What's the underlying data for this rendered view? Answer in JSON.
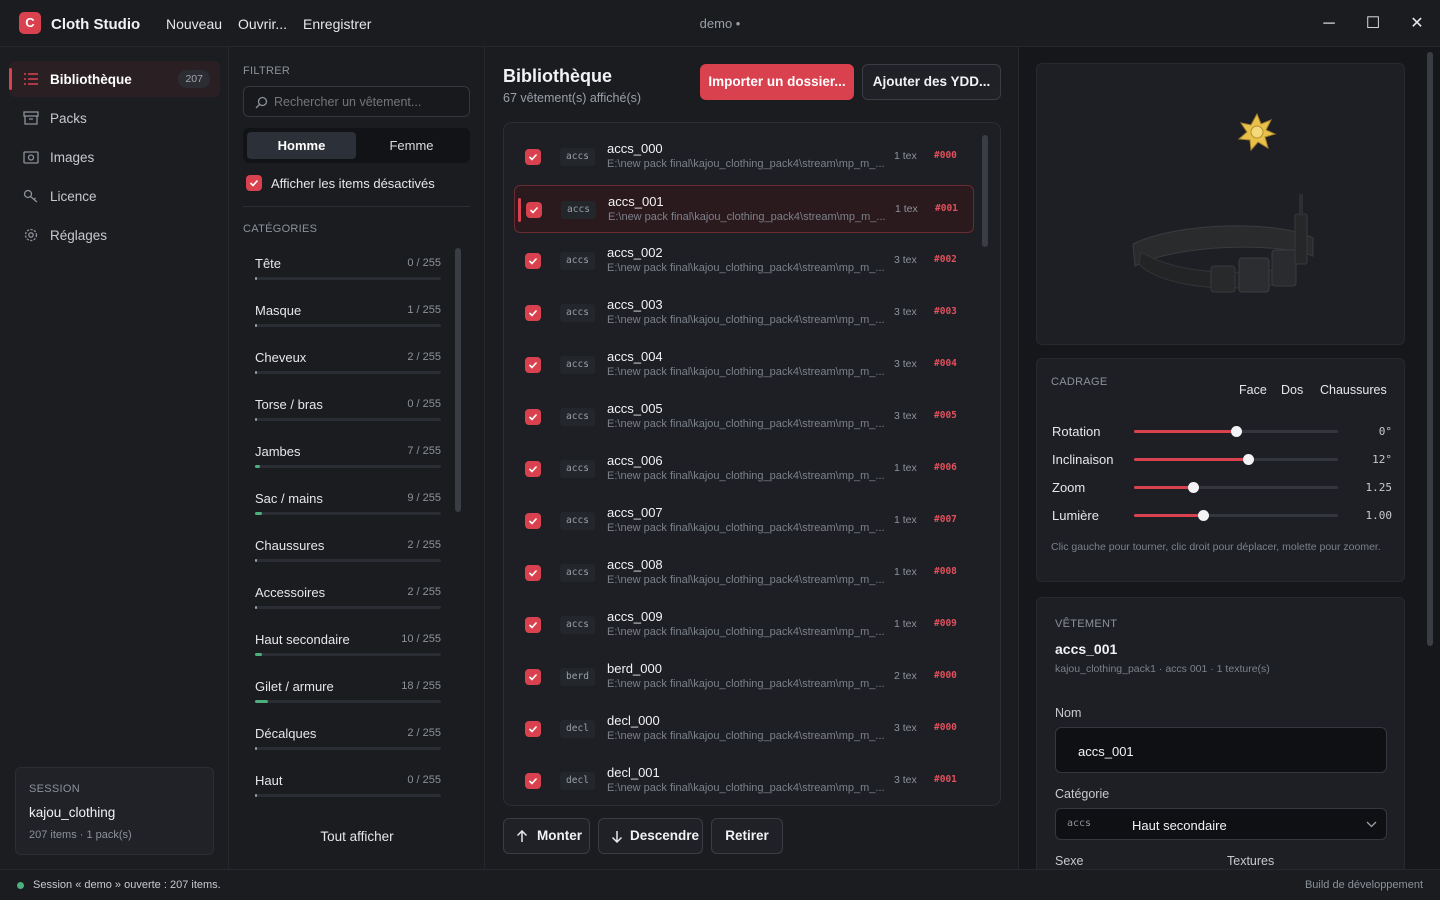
{
  "titlebar": {
    "logo_letter": "C",
    "app_name": "Cloth Studio",
    "menu": [
      "Nouveau",
      "Ouvrir...",
      "Enregistrer"
    ],
    "doc_title": "demo •",
    "controls": {
      "minimize": "─",
      "maximize": "☐",
      "close": "✕"
    }
  },
  "sidebar": {
    "items": [
      {
        "label": "Bibliothèque",
        "icon": "list-icon",
        "count": "207",
        "active": true
      },
      {
        "label": "Packs",
        "icon": "box-icon"
      },
      {
        "label": "Images",
        "icon": "image-icon"
      },
      {
        "label": "Licence",
        "icon": "key-icon"
      },
      {
        "label": "Réglages",
        "icon": "gear-icon"
      }
    ],
    "session": {
      "heading": "SESSION",
      "name": "kajou_clothing",
      "meta": "207 items · 1 pack(s)"
    }
  },
  "filter": {
    "heading": "FILTRER",
    "search_placeholder": "Rechercher un vêtement...",
    "gender": {
      "male": "Homme",
      "female": "Femme"
    },
    "show_disabled": "Afficher les items désactivés",
    "categories_heading": "CATÉGORIES",
    "categories": [
      {
        "name": "Tête",
        "count": "0 / 255",
        "fill": 0
      },
      {
        "name": "Masque",
        "count": "1 / 255",
        "fill": 0.004
      },
      {
        "name": "Cheveux",
        "count": "2 / 255",
        "fill": 0.008
      },
      {
        "name": "Torse / bras",
        "count": "0 / 255",
        "fill": 0
      },
      {
        "name": "Jambes",
        "count": "7 / 255",
        "fill": 0.027
      },
      {
        "name": "Sac / mains",
        "count": "9 / 255",
        "fill": 0.035
      },
      {
        "name": "Chaussures",
        "count": "2 / 255",
        "fill": 0.008
      },
      {
        "name": "Accessoires",
        "count": "2 / 255",
        "fill": 0.008
      },
      {
        "name": "Haut secondaire",
        "count": "10 / 255",
        "fill": 0.039
      },
      {
        "name": "Gilet / armure",
        "count": "18 / 255",
        "fill": 0.071
      },
      {
        "name": "Décalques",
        "count": "2 / 255",
        "fill": 0.008
      },
      {
        "name": "Haut",
        "count": "0 / 255",
        "fill": 0
      }
    ],
    "show_all": "Tout afficher"
  },
  "library": {
    "title": "Bibliothèque",
    "subtitle": "67 vêtement(s) affiché(s)",
    "import_button": "Importer un dossier...",
    "add_button": "Ajouter des YDD...",
    "rows": [
      {
        "tag": "accs",
        "name": "accs_000",
        "path": "E:\\new pack final\\kajou_clothing_pack4\\stream\\mp_m_...",
        "tex": "1 tex",
        "id": "#000"
      },
      {
        "tag": "accs",
        "name": "accs_001",
        "path": "E:\\new pack final\\kajou_clothing_pack4\\stream\\mp_m_...",
        "tex": "1 tex",
        "id": "#001",
        "selected": true
      },
      {
        "tag": "accs",
        "name": "accs_002",
        "path": "E:\\new pack final\\kajou_clothing_pack4\\stream\\mp_m_...",
        "tex": "3 tex",
        "id": "#002"
      },
      {
        "tag": "accs",
        "name": "accs_003",
        "path": "E:\\new pack final\\kajou_clothing_pack4\\stream\\mp_m_...",
        "tex": "3 tex",
        "id": "#003"
      },
      {
        "tag": "accs",
        "name": "accs_004",
        "path": "E:\\new pack final\\kajou_clothing_pack4\\stream\\mp_m_...",
        "tex": "3 tex",
        "id": "#004"
      },
      {
        "tag": "accs",
        "name": "accs_005",
        "path": "E:\\new pack final\\kajou_clothing_pack4\\stream\\mp_m_...",
        "tex": "3 tex",
        "id": "#005"
      },
      {
        "tag": "accs",
        "name": "accs_006",
        "path": "E:\\new pack final\\kajou_clothing_pack4\\stream\\mp_m_...",
        "tex": "1 tex",
        "id": "#006"
      },
      {
        "tag": "accs",
        "name": "accs_007",
        "path": "E:\\new pack final\\kajou_clothing_pack4\\stream\\mp_m_...",
        "tex": "1 tex",
        "id": "#007"
      },
      {
        "tag": "accs",
        "name": "accs_008",
        "path": "E:\\new pack final\\kajou_clothing_pack4\\stream\\mp_m_...",
        "tex": "1 tex",
        "id": "#008"
      },
      {
        "tag": "accs",
        "name": "accs_009",
        "path": "E:\\new pack final\\kajou_clothing_pack4\\stream\\mp_m_...",
        "tex": "1 tex",
        "id": "#009"
      },
      {
        "tag": "berd",
        "name": "berd_000",
        "path": "E:\\new pack final\\kajou_clothing_pack4\\stream\\mp_m_...",
        "tex": "2 tex",
        "id": "#000"
      },
      {
        "tag": "decl",
        "name": "decl_000",
        "path": "E:\\new pack final\\kajou_clothing_pack4\\stream\\mp_m_...",
        "tex": "3 tex",
        "id": "#000"
      },
      {
        "tag": "decl",
        "name": "decl_001",
        "path": "E:\\new pack final\\kajou_clothing_pack4\\stream\\mp_m_...",
        "tex": "3 tex",
        "id": "#001"
      }
    ],
    "move_up": "Monter",
    "move_down": "Descendre",
    "remove": "Retirer"
  },
  "cadrage": {
    "heading": "CADRAGE",
    "views": [
      "Face",
      "Dos",
      "Chaussures"
    ],
    "sliders": [
      {
        "label": "Rotation",
        "value": "0°",
        "level": 0.5
      },
      {
        "label": "Inclinaison",
        "value": "12°",
        "level": 0.56
      },
      {
        "label": "Zoom",
        "value": "1.25",
        "level": 0.29
      },
      {
        "label": "Lumière",
        "value": "1.00",
        "level": 0.34
      }
    ],
    "hint": "Clic gauche pour tourner, clic droit pour déplacer, molette pour zoomer."
  },
  "vetement": {
    "heading": "VÊTEMENT",
    "title": "accs_001",
    "meta": "kajou_clothing_pack1 · accs 001 · 1 texture(s)",
    "name_label": "Nom",
    "name_value": "accs_001",
    "category_label": "Catégorie",
    "category_tag": "accs",
    "category_value": "Haut secondaire",
    "sex_label": "Sexe",
    "textures_label": "Textures"
  },
  "status": {
    "text": "Session « demo » ouverte : 207 items.",
    "build": "Build de développement",
    "dot_color": "#4caf7d"
  },
  "colors": {
    "accent": "#d9414e",
    "progress": "#4caf7d"
  }
}
